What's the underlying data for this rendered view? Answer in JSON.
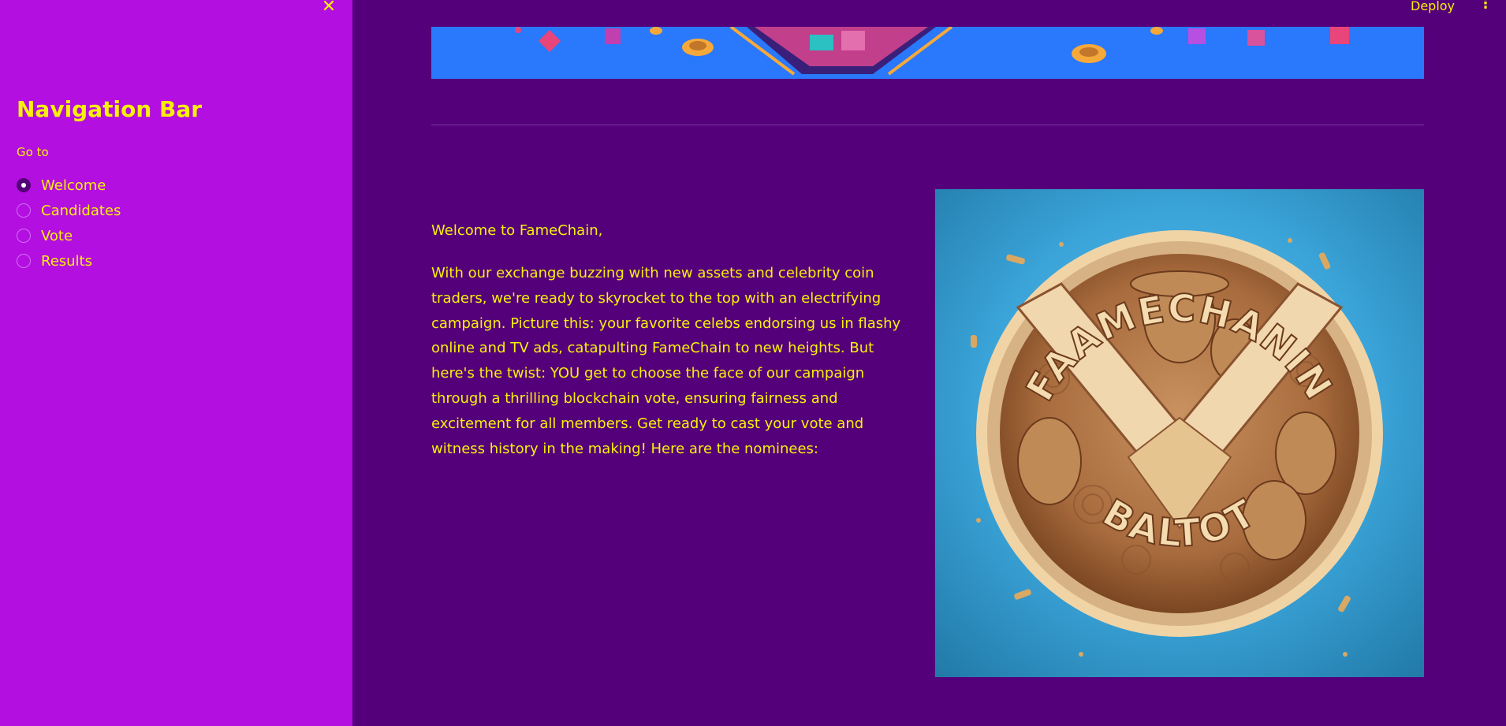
{
  "sidebar": {
    "title": "Navigation Bar",
    "close_icon": "close-icon",
    "goto_label": "Go to",
    "options": [
      {
        "label": "Welcome",
        "selected": true
      },
      {
        "label": "Candidates",
        "selected": false
      },
      {
        "label": "Vote",
        "selected": false
      },
      {
        "label": "Results",
        "selected": false
      }
    ]
  },
  "header": {
    "deploy_label": "Deploy",
    "menu_icon": "kebab-menu-icon"
  },
  "main": {
    "welcome": "Welcome to FameChain,",
    "body": "With our exchange buzzing with new assets and celebrity coin traders, we're ready to skyrocket to the top with an electrifying campaign. Picture this: your favorite celebs endorsing us in flashy online and TV ads, catapulting FameChain to new heights. But here's the twist: YOU get to choose the face of our campaign through a thrilling blockchain vote, ensuring fairness and excitement for all members. Get ready to cast your vote and witness history in the making! Here are the nominees:",
    "coin_top_text": "FAAMECHANIN",
    "coin_bottom_text": "BALTOT"
  },
  "colors": {
    "sidebar_bg": "#b30fe0",
    "main_bg": "#54007a",
    "text": "#f7f00a",
    "banner": "#2a7bff",
    "coin_bg": "#3aa3d8"
  }
}
